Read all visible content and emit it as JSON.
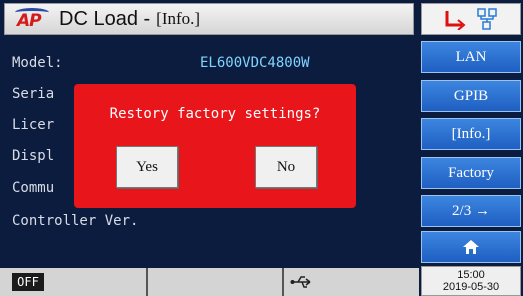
{
  "title": {
    "logo": "AP",
    "app": "DC Load -",
    "section": "[Info.]"
  },
  "info_rows": [
    {
      "label": "Model:",
      "value": "EL600VDC4800W"
    },
    {
      "label": "Seria",
      "value": ""
    },
    {
      "label": "Licer",
      "value": ""
    },
    {
      "label": "Displ",
      "value": ""
    },
    {
      "label": "Commu",
      "value": ""
    },
    {
      "label": "Controller Ver.",
      "value": ""
    }
  ],
  "sidebar": {
    "buttons": [
      "LAN",
      "GPIB",
      "[Info.]",
      "Factory",
      "2/3 →"
    ],
    "home_icon": "home-icon"
  },
  "status": {
    "output_state": "OFF",
    "usb_icon": "usb-icon"
  },
  "clock": {
    "time": "15:00",
    "date": "2019-05-30"
  },
  "dialog": {
    "message": "Restory factory settings?",
    "yes_label": "Yes",
    "no_label": "No"
  },
  "colors": {
    "background": "#0b1c3e",
    "dialog": "#e8151b",
    "sidebar_button": "#2f74d6",
    "value_text": "#7fd3ff"
  }
}
